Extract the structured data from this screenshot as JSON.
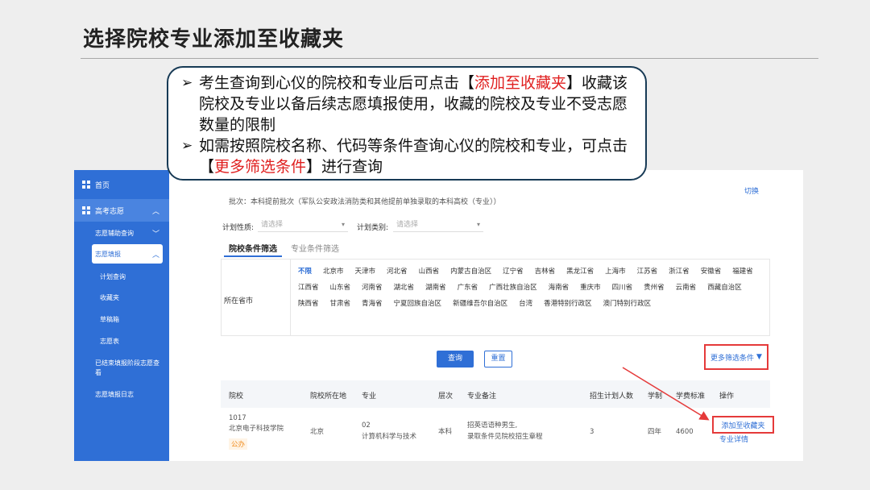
{
  "slide": {
    "title": "选择院校专业添加至收藏夹"
  },
  "callout": {
    "bullet1_a": "考生查询到心仪的院校和专业后可点击【",
    "bullet1_red": "添加至收藏夹",
    "bullet1_b": "】收藏该院校及专业以备后续志愿填报使用，收藏的院校及专业不受志愿数量的限制",
    "bullet2_a": "如需按照院校名称、代码等条件查询心仪的院校和专业，可点击【",
    "bullet2_red": "更多筛选条件",
    "bullet2_b": "】进行查询"
  },
  "sidebar": {
    "home": "首页",
    "group": "高考志愿",
    "aid": "志愿辅助查询",
    "fill": "志愿填报",
    "plan": "计划查询",
    "favorites": "收藏夹",
    "draft": "草稿箱",
    "table": "志愿表",
    "finished": "已结束填报阶段志愿查看",
    "log": "志愿填报日志"
  },
  "main": {
    "batch": "批次：本科提前批次（军队公安政法消防类和其他提前单独录取的本科高校（专业））",
    "switch": "切换",
    "plan_nature_label": "计划性质:",
    "plan_nature_placeholder": "请选择",
    "plan_type_label": "计划类别:",
    "plan_type_placeholder": "请选择",
    "tab_school": "院校条件筛选",
    "tab_major": "专业条件筛选",
    "province_label": "所在省市",
    "provinces": [
      "不限",
      "北京市",
      "天津市",
      "河北省",
      "山西省",
      "内蒙古自治区",
      "辽宁省",
      "吉林省",
      "黑龙江省",
      "上海市",
      "江苏省",
      "浙江省",
      "安徽省",
      "福建省",
      "江西省",
      "山东省",
      "河南省",
      "湖北省",
      "湖南省",
      "广东省",
      "广西壮族自治区",
      "海南省",
      "重庆市",
      "四川省",
      "贵州省",
      "云南省",
      "西藏自治区",
      "陕西省",
      "甘肃省",
      "青海省",
      "宁夏回族自治区",
      "新疆维吾尔自治区",
      "台湾",
      "香港特别行政区",
      "澳门特别行政区"
    ],
    "query_btn": "查询",
    "reset_btn": "重置",
    "more_filters": "更多筛选条件",
    "table": {
      "headers": [
        "院校",
        "院校所在地",
        "专业",
        "层次",
        "专业备注",
        "招生计划人数",
        "学制",
        "学费标准",
        "操作"
      ],
      "row": {
        "code": "1017",
        "school": "北京电子科技学院",
        "tag": "公办",
        "location": "北京",
        "major_code": "02",
        "major": "计算机科学与技术",
        "level": "本科",
        "note1": "招英语语种男生,",
        "note2": "录取条件见院校招生章程",
        "plan": "3",
        "duration": "四年",
        "fee": "4600",
        "add_fav": "添加至收藏夹",
        "detail": "专业详情"
      }
    }
  },
  "colors": {
    "primary": "#2f6fd6",
    "highlight": "#e53a3a"
  }
}
